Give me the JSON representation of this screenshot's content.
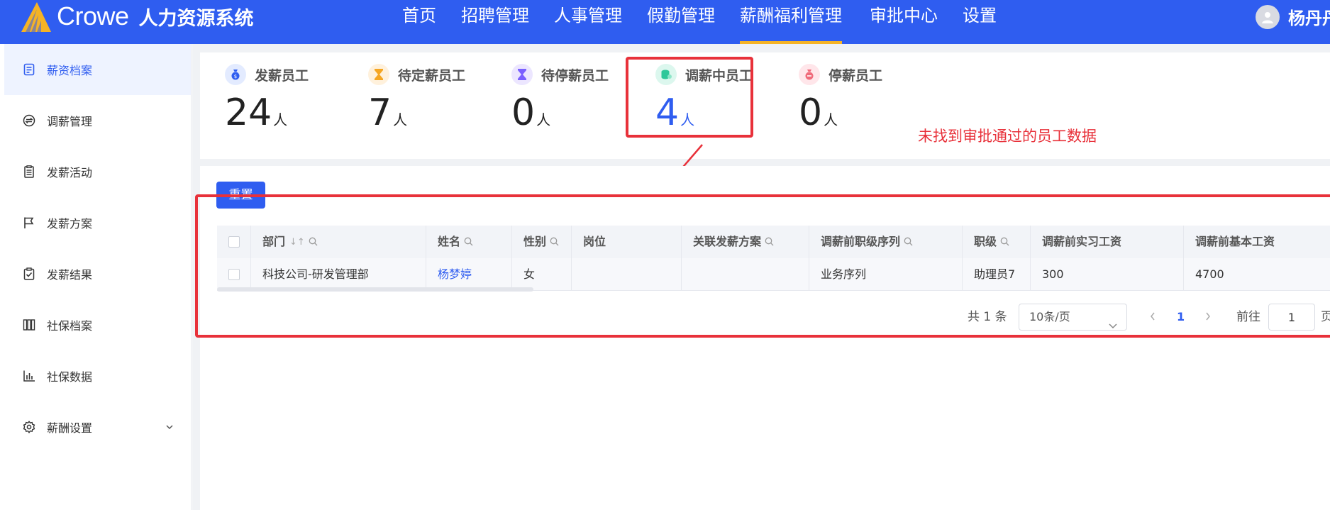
{
  "header": {
    "brand": "Crowe",
    "system_name": "人力资源系统",
    "nav": [
      {
        "label": "首页",
        "active": false
      },
      {
        "label": "招聘管理",
        "active": false
      },
      {
        "label": "人事管理",
        "active": false
      },
      {
        "label": "假勤管理",
        "active": false
      },
      {
        "label": "薪酬福利管理",
        "active": true
      },
      {
        "label": "审批中心",
        "active": false
      },
      {
        "label": "设置",
        "active": false
      }
    ],
    "user_name": "杨丹丹"
  },
  "sidebar": {
    "items": [
      {
        "label": "薪资档案",
        "icon": "document-icon",
        "active": true
      },
      {
        "label": "调薪管理",
        "icon": "exchange-icon",
        "active": false
      },
      {
        "label": "发薪活动",
        "icon": "list-icon",
        "active": false
      },
      {
        "label": "发薪方案",
        "icon": "flag-icon",
        "active": false
      },
      {
        "label": "发薪结果",
        "icon": "clipboard-check-icon",
        "active": false
      },
      {
        "label": "社保档案",
        "icon": "archive-icon",
        "active": false
      },
      {
        "label": "社保数据",
        "icon": "bar-chart-icon",
        "active": false
      },
      {
        "label": "薪酬设置",
        "icon": "gear-icon",
        "active": false,
        "expandable": true
      }
    ]
  },
  "stats": [
    {
      "title": "发薪员工",
      "value": "24",
      "unit": "人",
      "icon": "money-bag-icon",
      "color": "#2f5df0"
    },
    {
      "title": "待定薪员工",
      "value": "7",
      "unit": "人",
      "icon": "hourglass-icon",
      "color": "#f5a623"
    },
    {
      "title": "待停薪员工",
      "value": "0",
      "unit": "人",
      "icon": "hourglass-icon",
      "color": "#7b61ff"
    },
    {
      "title": "调薪中员工",
      "value": "4",
      "unit": "人",
      "icon": "coin-icon",
      "color": "#2fc79a",
      "highlighted": true
    },
    {
      "title": "停薪员工",
      "value": "0",
      "unit": "人",
      "icon": "money-stop-icon",
      "color": "#f06a7a"
    }
  ],
  "annotation": "未找到审批通过的员工数据",
  "toolbar": {
    "reset_label": "重置"
  },
  "table": {
    "columns": [
      "部门",
      "姓名",
      "性别",
      "岗位",
      "关联发薪方案",
      "调薪前职级序列",
      "职级",
      "调薪前实习工资",
      "调薪前基本工资"
    ],
    "rows": [
      [
        "科技公司-研发管理部",
        "杨梦婷",
        "女",
        "",
        "",
        "业务序列",
        "助理员7",
        "300",
        "4700"
      ]
    ]
  },
  "pagination": {
    "total": "共 1 条",
    "page_size": "10条/页",
    "current_page": "1",
    "goto_label": "前往",
    "goto_value": "1",
    "page_suffix": "页"
  },
  "colors": {
    "primary": "#2f5df0",
    "accent_underline": "#f5b326",
    "annotation_red": "#e8313a"
  }
}
